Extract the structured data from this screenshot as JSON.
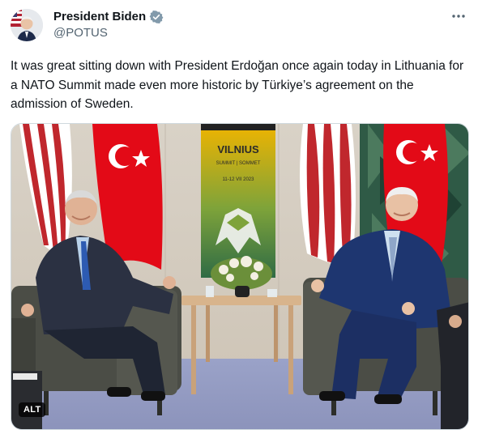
{
  "author": {
    "display_name": "President Biden",
    "handle": "@POTUS",
    "verified_icon": "verified-badge-icon",
    "verified_color": "#829aab"
  },
  "menu": {
    "icon": "more-horizontal-icon"
  },
  "tweet": {
    "text": "It was great sitting down with President Erdoğan once again today in Lithuania for a NATO Summit made even more historic by Türkiye’s agreement on the admission of Sweden."
  },
  "photo": {
    "backdrop": {
      "title": "VILNIUS",
      "subtitle": "SUMMIT | SOMMET",
      "dates": "11-12 VII 2023"
    },
    "alt_label": "ALT"
  },
  "colors": {
    "text_primary": "#0f1419",
    "text_secondary": "#536471",
    "border": "#cfd9de"
  }
}
